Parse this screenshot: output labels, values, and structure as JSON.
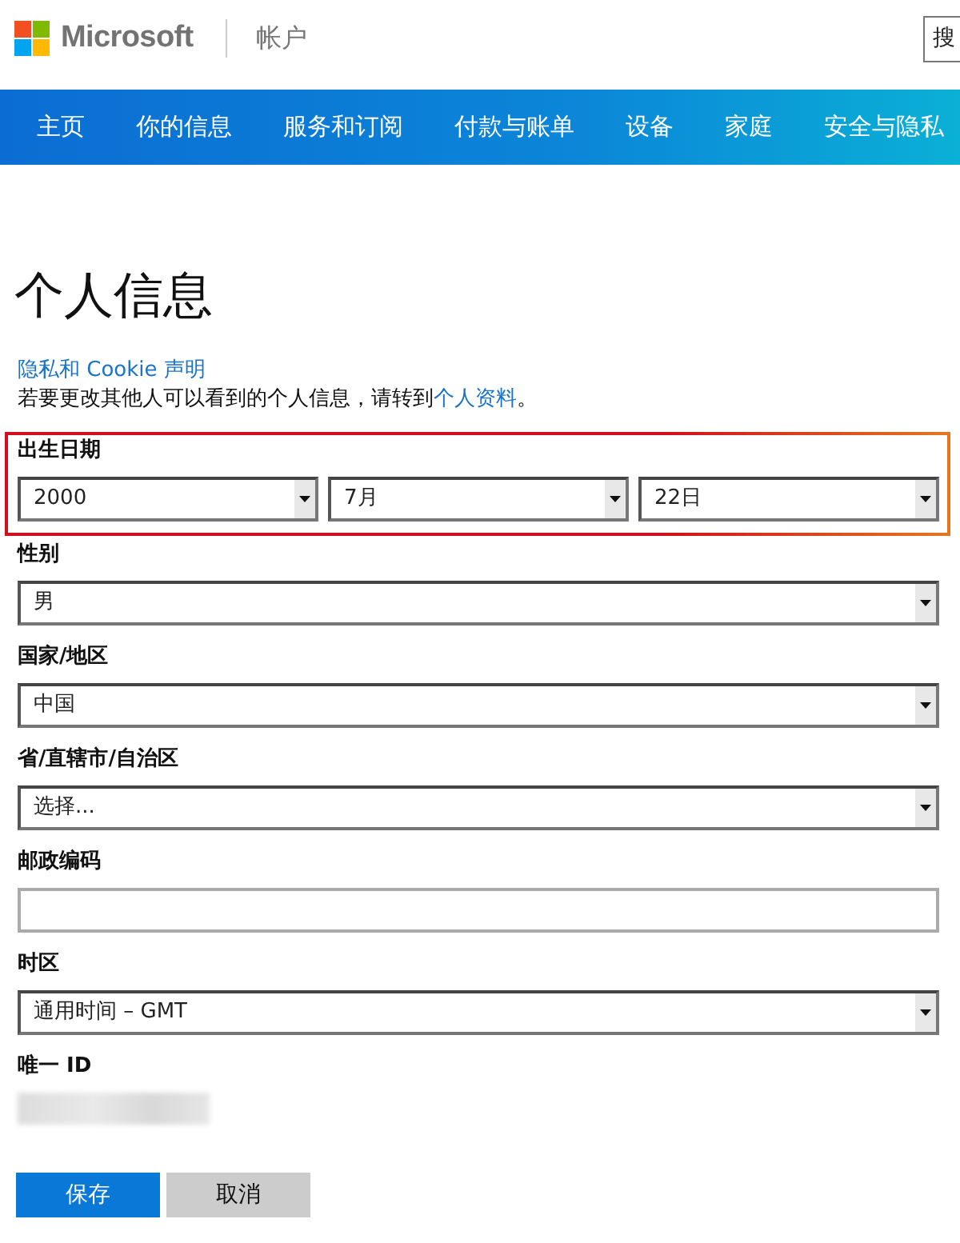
{
  "header": {
    "logo_text": "Microsoft",
    "section": "帐户",
    "search_button": "搜"
  },
  "nav": {
    "items": [
      {
        "label": "主页"
      },
      {
        "label": "你的信息"
      },
      {
        "label": "服务和订阅"
      },
      {
        "label": "付款与账单"
      },
      {
        "label": "设备"
      },
      {
        "label": "家庭"
      },
      {
        "label": "安全与隐私"
      }
    ]
  },
  "page": {
    "title": "个人信息",
    "privacy_link": "隐私和 Cookie 声明",
    "note": {
      "text_before": "若要更改其他人可以看到的个人信息，请转到",
      "link": "个人资料",
      "text_after": "。"
    }
  },
  "form": {
    "fields": [
      {
        "kind": "date",
        "label": "出生日期",
        "highlighted": true,
        "selects": [
          "2000",
          "7月",
          "22日"
        ]
      },
      {
        "kind": "select",
        "label": "性别",
        "highlighted": false,
        "value": "男"
      },
      {
        "kind": "select",
        "label": "国家/地区",
        "highlighted": false,
        "value": "中国"
      },
      {
        "kind": "select",
        "label": "省/直辖市/自治区",
        "highlighted": false,
        "value": "选择..."
      },
      {
        "kind": "text",
        "label": "邮政编码",
        "highlighted": false
      },
      {
        "kind": "select",
        "label": "时区",
        "highlighted": false,
        "value": "通用时间 – GMT"
      },
      {
        "kind": "redacted",
        "label": "唯一 ID",
        "highlighted": false
      }
    ]
  },
  "buttons": [
    {
      "kind": "primary",
      "label": "保存"
    },
    {
      "kind": "secondary",
      "label": "取消"
    }
  ]
}
